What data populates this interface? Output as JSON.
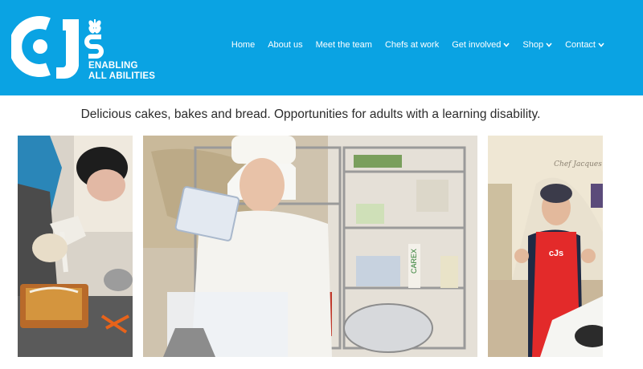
{
  "brand": {
    "tagline_line1": "ENABLING",
    "tagline_line2": "ALL ABILITIES",
    "color": "#0aa3e3"
  },
  "nav": {
    "items": [
      {
        "label": "Home",
        "dropdown": false
      },
      {
        "label": "About us",
        "dropdown": false
      },
      {
        "label": "Meet the team",
        "dropdown": false
      },
      {
        "label": "Chefs at work",
        "dropdown": false
      },
      {
        "label": "Get involved",
        "dropdown": true
      },
      {
        "label": "Shop",
        "dropdown": true
      },
      {
        "label": "Contact",
        "dropdown": true
      }
    ]
  },
  "hero": {
    "tagline": "Delicious cakes, bakes and bread. Opportunities for adults with a learning disability."
  },
  "gallery": {
    "photo_apron_text": "cJs",
    "photo_wall_text": "Chef Jacques",
    "photo_shelf_label": "CAREX"
  }
}
